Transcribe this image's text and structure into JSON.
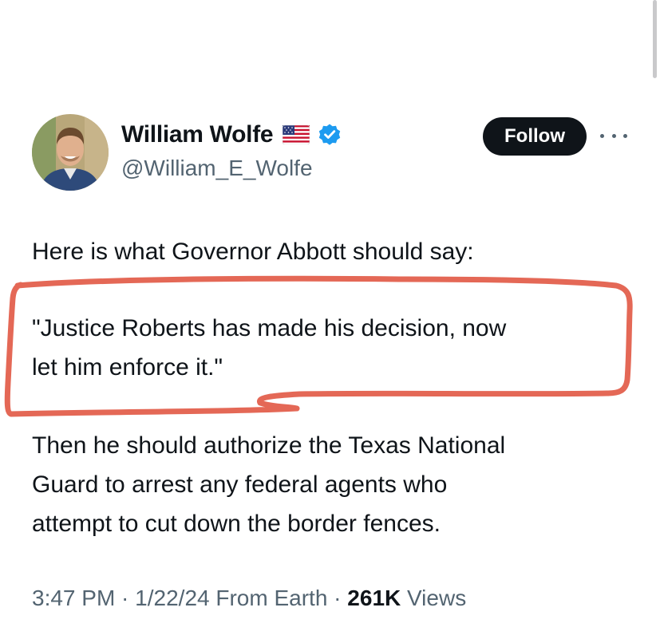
{
  "author": {
    "display_name": "William Wolfe",
    "flag_icon": "us-flag-icon",
    "verified_icon": "verified-badge-icon",
    "verified_color": "#1d9bf0",
    "handle": "@William_E_Wolfe"
  },
  "actions": {
    "follow_label": "Follow",
    "more_icon": "more-options-icon"
  },
  "tweet": {
    "intro": "Here is what Governor Abbott should say:",
    "quote_lines": [
      "\"Justice Roberts has made his decision, now",
      "let him enforce it.\""
    ],
    "body_lines": [
      "Then he should authorize the Texas National",
      "Guard to arrest any federal agents who",
      "attempt to cut down the border fences."
    ]
  },
  "meta": {
    "time": "3:47 PM",
    "date": "1/22/24",
    "source": "From Earth",
    "separator": " · ",
    "views_count": "261K",
    "views_label": "Views"
  },
  "annotation": {
    "color": "#e0533f"
  }
}
